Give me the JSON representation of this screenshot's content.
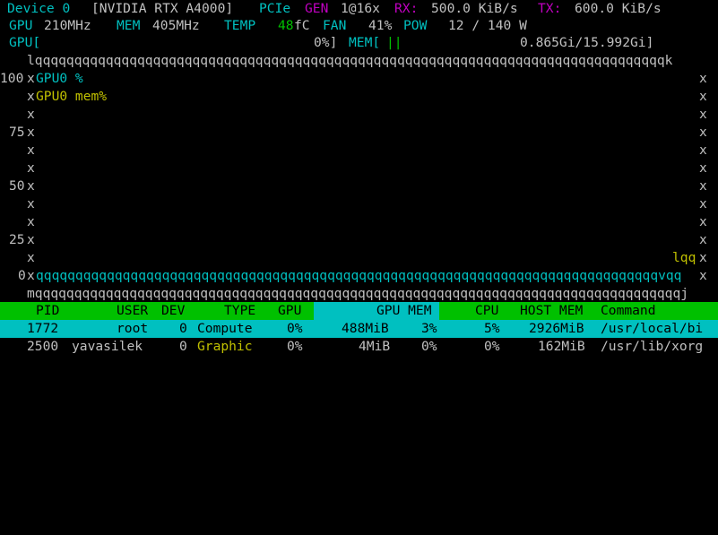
{
  "header": {
    "device_label": "Device 0",
    "device_name": "[NVIDIA RTX A4000]",
    "pcie_label": "PCIe",
    "gen_label": "GEN",
    "gen_value": "1@16x",
    "rx_label": "RX:",
    "rx_value": "500.0 KiB/s",
    "tx_label": "TX:",
    "tx_value": "600.0 KiB/s",
    "gpu_label": "GPU",
    "gpu_clock": "210MHz",
    "mem_label": "MEM",
    "mem_clock": "405MHz",
    "temp_label": "TEMP",
    "temp_value": "48",
    "temp_unit": "fC",
    "fan_label": "FAN",
    "fan_value": "41%",
    "pow_label": "POW",
    "pow_value": "12 / 140 W"
  },
  "bars": {
    "gpu_label": "GPU[",
    "gpu_value": "0%]",
    "mem_label": "MEM[",
    "mem_fill": "||",
    "mem_value": "0.865Gi/15.992Gi]"
  },
  "chart": {
    "top_border": "lqqqqqqqqqqqqqqqqqqqqqqqqqqqqqqqqqqqqqqqqqqqqqqqqqqqqqqqqqqqqqqqqqqqqqqqqqqqqqqqqk",
    "legend_gpu": "GPU0 %",
    "legend_mem": "GPU0 mem%",
    "ticks": [
      "100",
      "75",
      "50",
      "25",
      "0"
    ],
    "side": "x",
    "lqq": "lqq",
    "bottom_axis": "qqqqqqqqqqqqqqqqqqqqqqqqqqqqqqqqqqqqqqqqqqqqqqqqqqqqqqqqqqqqqqqqqqqqqqqqqqqqqqqvqq",
    "bottom_border": "mqqqqqqqqqqqqqqqqqqqqqqqqqqqqqqqqqqqqqqqqqqqqqqqqqqqqqqqqqqqqqqqqqqqqqqqqqqqqqqqqqqj"
  },
  "table": {
    "headers": {
      "pid": "PID",
      "user": "USER",
      "dev": "DEV",
      "type": "TYPE",
      "gpu": "GPU",
      "gpu_mem": "GPU MEM",
      "cpu": "CPU",
      "host_mem": "HOST MEM",
      "command": "Command"
    },
    "rows": [
      {
        "pid": "1772",
        "user": "root",
        "dev": "0",
        "type": "Compute",
        "gpu": "0%",
        "gpu_mem_amt": "488MiB",
        "gpu_mem_pct": "3%",
        "cpu": "5%",
        "host_mem": "2926MiB",
        "command": "/usr/local/bi"
      },
      {
        "pid": "2500",
        "user": "yavasilek",
        "dev": "0",
        "type": "Graphic",
        "gpu": "0%",
        "gpu_mem_amt": "4MiB",
        "gpu_mem_pct": "0%",
        "cpu": "0%",
        "host_mem": "162MiB",
        "command": "/usr/lib/xorg"
      }
    ]
  }
}
